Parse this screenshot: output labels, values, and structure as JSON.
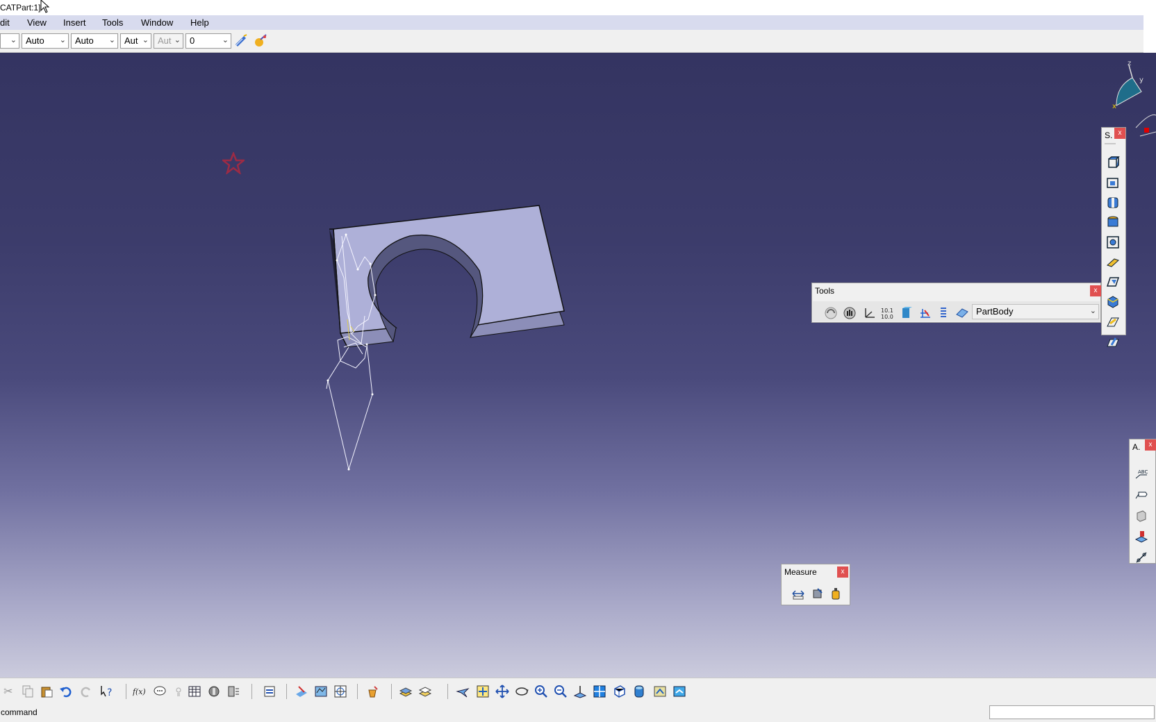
{
  "window": {
    "title": "CATPart:1]"
  },
  "menu": [
    "dit",
    "View",
    "Insert",
    "Tools",
    "Window",
    "Help"
  ],
  "properties_toolbar": {
    "combo1": "",
    "combo2": "Auto",
    "combo3": "Auto",
    "combo4": "Aut",
    "combo5": "Aut",
    "combo6": "0"
  },
  "tools_panel": {
    "title": "Tools",
    "body_select": "PartBody",
    "close": "x"
  },
  "s_panel": {
    "title": "S.",
    "close": "x"
  },
  "a_panel": {
    "title": "A.",
    "close": "x"
  },
  "measure_panel": {
    "title": "Measure",
    "close": "x"
  },
  "compass": {
    "z": "z",
    "y": "y",
    "x": "x"
  },
  "status": {
    "command": "command"
  },
  "colors": {
    "viewport_top": "#343461",
    "viewport_bottom": "#cbcbdd",
    "part_face": "#aeb0d8",
    "close_button": "#e05050"
  }
}
